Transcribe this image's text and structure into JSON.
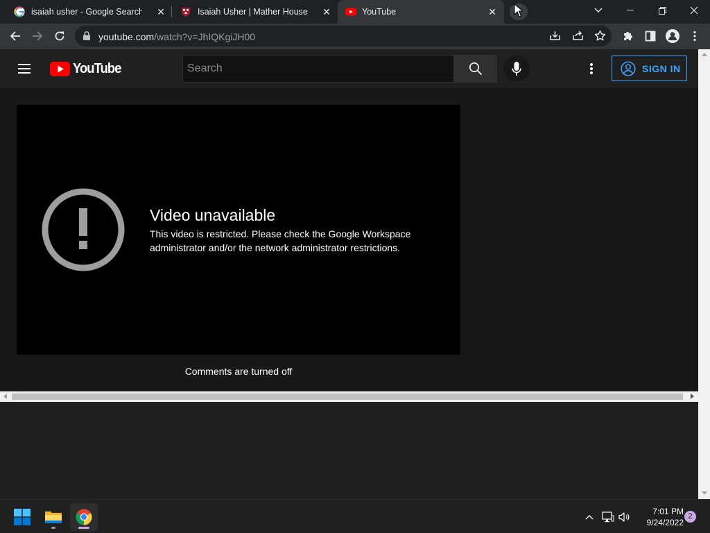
{
  "browser": {
    "tabs": [
      {
        "title": "isaiah usher - Google Search",
        "favicon": "google-icon",
        "active": false
      },
      {
        "title": "Isaiah Usher | Mather House",
        "favicon": "harvard-shield-icon",
        "active": false
      },
      {
        "title": "YouTube",
        "favicon": "youtube-icon",
        "active": true
      }
    ],
    "url_host": "youtube.com",
    "url_path": "/watch?v=JhIQKgiJH00"
  },
  "youtube": {
    "search_placeholder": "Search",
    "signin_label": "SIGN IN",
    "error_title": "Video unavailable",
    "error_message": "This video is restricted. Please check the Google Workspace administrator and/or the network administrator restrictions.",
    "comments_status": "Comments are turned off"
  },
  "taskbar": {
    "time": "7:01 PM",
    "date": "9/24/2022",
    "notification_count": "2"
  },
  "colors": {
    "accent_blue": "#3ea6ff",
    "youtube_red": "#ff0000",
    "chrome_tab_bg": "#202124",
    "chrome_toolbar_bg": "#35363a"
  }
}
